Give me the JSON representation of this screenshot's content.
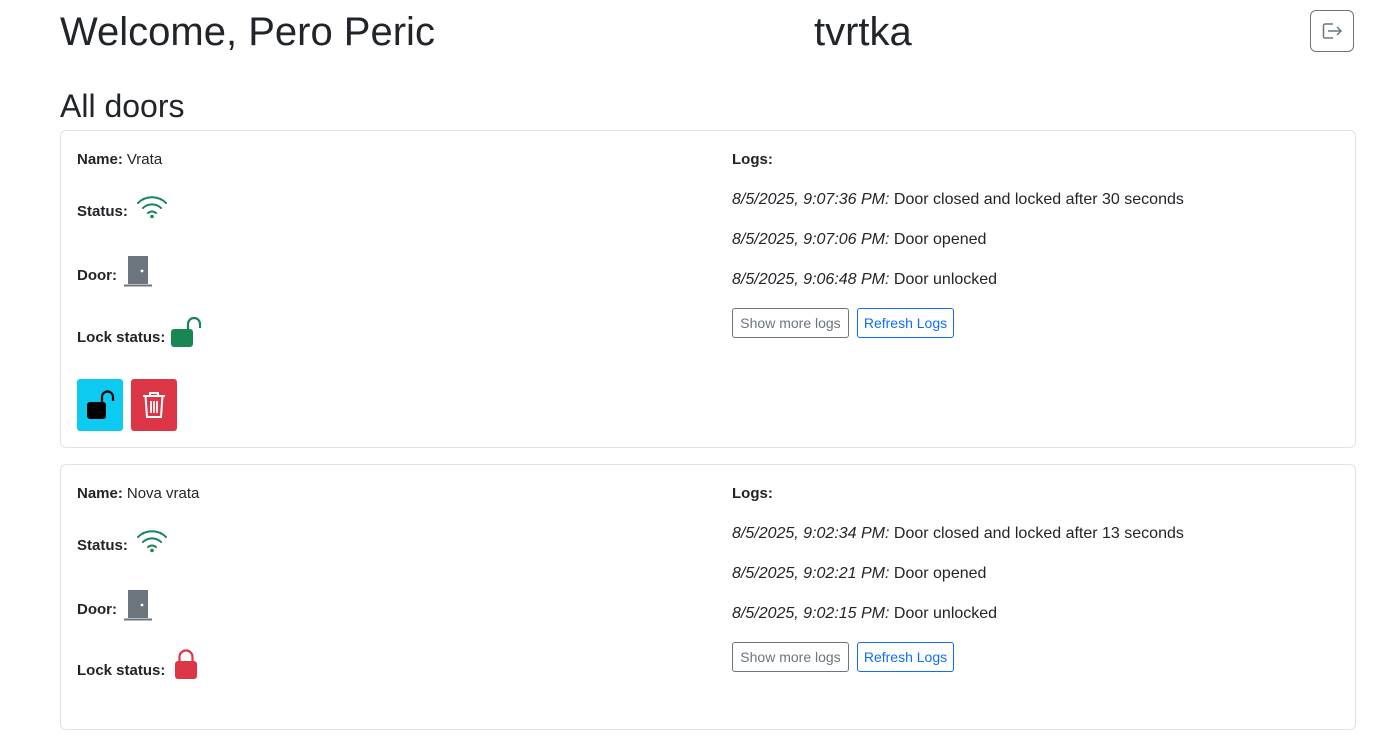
{
  "header": {
    "welcome_text": "Welcome, Pero Peric",
    "company_name": "tvrtka",
    "logout_icon": "box-arrow-right-icon"
  },
  "section_title": "All doors",
  "labels": {
    "name": "Name:",
    "status": "Status:",
    "door": "Door:",
    "lock_status": "Lock status:",
    "logs": "Logs:",
    "show_more": "Show more logs",
    "refresh": "Refresh Logs"
  },
  "colors": {
    "success": "#198754",
    "danger": "#dc3545",
    "info": "#0dcaf0",
    "secondary": "#6c757d",
    "primary": "#0d6efd"
  },
  "doors": [
    {
      "name": "Vrata",
      "status_icon": "wifi-icon",
      "door_icon": "door-closed-icon",
      "lock_status": "unlocked",
      "lock_icon": "unlock-icon",
      "logs": [
        {
          "time": "8/5/2025, 9:07:36 PM:",
          "message": "Door closed and locked after 30 seconds"
        },
        {
          "time": "8/5/2025, 9:07:06 PM:",
          "message": "Door opened"
        },
        {
          "time": "8/5/2025, 9:06:48 PM:",
          "message": "Door unlocked"
        }
      ],
      "actions": [
        "unlock-button",
        "delete-button"
      ]
    },
    {
      "name": "Nova vrata",
      "status_icon": "wifi-icon",
      "door_icon": "door-closed-icon",
      "lock_status": "locked",
      "lock_icon": "lock-icon",
      "logs": [
        {
          "time": "8/5/2025, 9:02:34 PM:",
          "message": "Door closed and locked after 13 seconds"
        },
        {
          "time": "8/5/2025, 9:02:21 PM:",
          "message": "Door opened"
        },
        {
          "time": "8/5/2025, 9:02:15 PM:",
          "message": "Door unlocked"
        }
      ]
    }
  ]
}
